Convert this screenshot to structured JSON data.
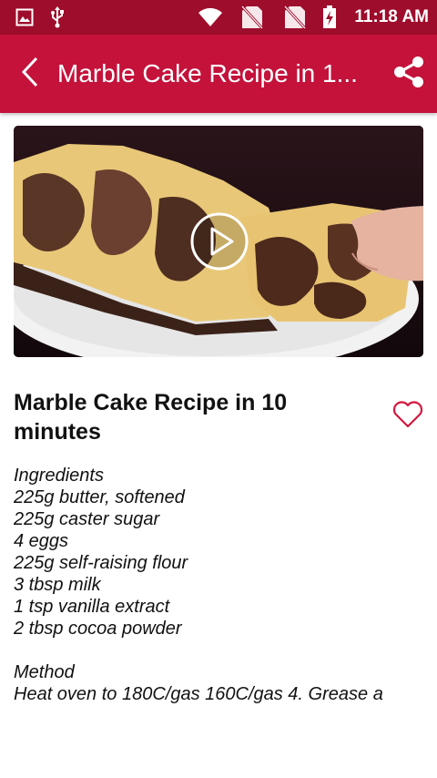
{
  "status_bar": {
    "time": "11:18 AM",
    "icons": [
      "gallery-icon",
      "usb-icon",
      "wifi-icon",
      "no-sim-icon",
      "no-sim-icon",
      "battery-charging-icon"
    ]
  },
  "app_bar": {
    "title": "Marble Cake Recipe in 1...",
    "back_icon": "chevron-left-icon",
    "share_icon": "share-icon"
  },
  "video": {
    "thumbnail": "marble cake slices on a plate",
    "play_icon": "play-circle-icon"
  },
  "recipe": {
    "title": "Marble Cake Recipe in 10 minutes",
    "favorite_icon": "heart-outline-icon",
    "lines": [
      "Ingredients",
      "225g butter, softened",
      "225g caster sugar",
      "4 eggs",
      "225g self-raising flour",
      "3 tbsp milk",
      "1 tsp vanilla extract",
      "2 tbsp cocoa powder",
      "",
      "Method",
      "Heat oven to 180C/gas 160C/gas 4. Grease a"
    ]
  },
  "colors": {
    "status_bar": "#9f0d2c",
    "app_bar": "#c4123b",
    "favorite": "#d6173f"
  }
}
